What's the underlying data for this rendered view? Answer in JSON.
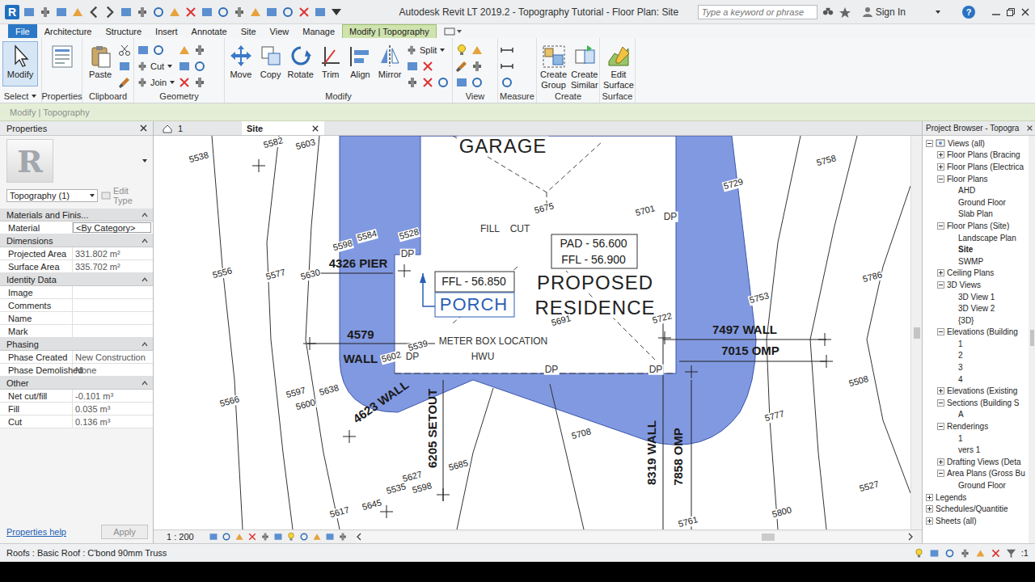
{
  "window": {
    "logo": "R",
    "title": "Autodesk Revit LT 2019.2 - Topography Tutorial - Floor Plan: Site",
    "search_placeholder": "Type a keyword or phrase",
    "sign_in": "Sign In",
    "help": "?"
  },
  "ribbon_tabs": [
    {
      "label": "File",
      "selected": false
    },
    {
      "label": "Architecture",
      "selected": false
    },
    {
      "label": "Structure",
      "selected": false
    },
    {
      "label": "Insert",
      "selected": false
    },
    {
      "label": "Annotate",
      "selected": false
    },
    {
      "label": "Site",
      "selected": false
    },
    {
      "label": "View",
      "selected": false
    },
    {
      "label": "Manage",
      "selected": false
    },
    {
      "label": "Modify | Topography",
      "selected": true
    }
  ],
  "ribbon": {
    "panels": [
      {
        "title": "Select",
        "buttons": [
          {
            "label": "Modify",
            "kind": "large",
            "pressed": true
          }
        ]
      },
      {
        "title": "Properties",
        "buttons": []
      },
      {
        "title": "Clipboard",
        "buttons": [
          {
            "label": "Paste",
            "kind": "large",
            "pressed": false
          }
        ]
      },
      {
        "title": "Geometry",
        "buttons": [
          {
            "label": "Cut",
            "kind": "small",
            "pressed": false
          },
          {
            "label": "Join",
            "kind": "small",
            "pressed": false
          }
        ]
      },
      {
        "title": "Modify",
        "buttons": [
          {
            "label": "Move",
            "kind": "large",
            "pressed": false
          },
          {
            "label": "Copy",
            "kind": "large",
            "pressed": false
          },
          {
            "label": "Rotate",
            "kind": "large",
            "pressed": false
          },
          {
            "label": "Trim",
            "kind": "large",
            "pressed": false
          },
          {
            "label": "Align",
            "kind": "large",
            "pressed": false
          },
          {
            "label": "Mirror",
            "kind": "large",
            "pressed": false
          },
          {
            "label": "Split",
            "kind": "small",
            "pressed": false
          }
        ]
      },
      {
        "title": "View",
        "buttons": []
      },
      {
        "title": "Measure",
        "buttons": []
      },
      {
        "title": "Create",
        "buttons": [
          {
            "label": "Create Group",
            "kind": "large",
            "pressed": false
          },
          {
            "label": "Create Similar",
            "kind": "large",
            "pressed": false
          }
        ]
      },
      {
        "title": "Surface",
        "buttons": [
          {
            "label": "Edit Surface",
            "kind": "large",
            "pressed": false
          }
        ]
      }
    ]
  },
  "options_bar": {
    "text": "Modify | Topography"
  },
  "properties": {
    "title": "Properties",
    "type_image": "R",
    "type_selector": "Topography (1)",
    "edit_type": {
      "label": "Edit Type",
      "disabled": true
    },
    "groups": [
      {
        "title": "Materials and Finis...",
        "rows": [
          {
            "name": "Material",
            "value": "<By Category>",
            "kind": "field"
          }
        ]
      },
      {
        "title": "Dimensions",
        "rows": [
          {
            "name": "Projected Area",
            "value": "331.802 m²",
            "kind": "readonly"
          },
          {
            "name": "Surface Area",
            "value": "335.702 m²",
            "kind": "readonly"
          }
        ]
      },
      {
        "title": "Identity Data",
        "rows": [
          {
            "name": "Image",
            "value": "",
            "kind": "readonly"
          },
          {
            "name": "Comments",
            "value": "",
            "kind": "readonly"
          },
          {
            "name": "Name",
            "value": "",
            "kind": "readonly"
          },
          {
            "name": "Mark",
            "value": "",
            "kind": "readonly"
          }
        ]
      },
      {
        "title": "Phasing",
        "rows": [
          {
            "name": "Phase Created",
            "value": "New Construction",
            "kind": "readonly"
          },
          {
            "name": "Phase Demolished",
            "value": "None",
            "kind": "readonly"
          }
        ]
      },
      {
        "title": "Other",
        "rows": [
          {
            "name": "Net cut/fill",
            "value": "-0.101 m³",
            "kind": "readonly"
          },
          {
            "name": "Fill",
            "value": "0.035 m³",
            "kind": "readonly"
          },
          {
            "name": "Cut",
            "value": "0.136 m³",
            "kind": "readonly"
          }
        ]
      }
    ],
    "help": "Properties help",
    "apply": {
      "label": "Apply",
      "disabled": true
    }
  },
  "view_tabs": [
    {
      "label": "1",
      "selected": false
    },
    {
      "label": "Site",
      "selected": true
    }
  ],
  "canvas": {
    "labels": [
      {
        "text": "5538",
        "kind": "elev"
      },
      {
        "text": "5582",
        "kind": "elev"
      },
      {
        "text": "5603",
        "kind": "elev"
      },
      {
        "text": "GARAGE",
        "kind": "title"
      },
      {
        "text": "5675",
        "kind": "elev"
      },
      {
        "text": "5701",
        "kind": "elev"
      },
      {
        "text": "DP",
        "kind": "note"
      },
      {
        "text": "5729",
        "kind": "elev"
      },
      {
        "text": "5758",
        "kind": "elev"
      },
      {
        "text": "FILL",
        "kind": "note"
      },
      {
        "text": "CUT",
        "kind": "note"
      },
      {
        "text": "PAD - 56.600",
        "kind": "note14"
      },
      {
        "text": "FFL - 56.900",
        "kind": "note14"
      },
      {
        "text": "5528",
        "kind": "elev"
      },
      {
        "text": "5598",
        "kind": "elev"
      },
      {
        "text": "5584",
        "kind": "elev"
      },
      {
        "text": "DP",
        "kind": "note"
      },
      {
        "text": "4326 PIER",
        "kind": "bold"
      },
      {
        "text": "5556",
        "kind": "elev"
      },
      {
        "text": "5577",
        "kind": "elev"
      },
      {
        "text": "5630",
        "kind": "elev"
      },
      {
        "text": "FFL - 56.850",
        "kind": "note14"
      },
      {
        "text": "PORCH",
        "kind": "porch"
      },
      {
        "text": "PROPOSED",
        "kind": "title"
      },
      {
        "text": "RESIDENCE",
        "kind": "title"
      },
      {
        "text": "5786",
        "kind": "elev"
      },
      {
        "text": "5753",
        "kind": "elev"
      },
      {
        "text": "5722",
        "kind": "elev"
      },
      {
        "text": "5691",
        "kind": "elev"
      },
      {
        "text": "7497 WALL",
        "kind": "bold"
      },
      {
        "text": "7015 OMP",
        "kind": "bold"
      },
      {
        "text": "4579",
        "kind": "bold"
      },
      {
        "text": "WALL",
        "kind": "bold"
      },
      {
        "text": "METER BOX LOCATION",
        "kind": "note"
      },
      {
        "text": "HWU",
        "kind": "note"
      },
      {
        "text": "5539",
        "kind": "elev"
      },
      {
        "text": "5602",
        "kind": "elev"
      },
      {
        "text": "DP",
        "kind": "note"
      },
      {
        "text": "DP",
        "kind": "note"
      },
      {
        "text": "DP",
        "kind": "note"
      },
      {
        "text": "5508",
        "kind": "elev"
      },
      {
        "text": "5566",
        "kind": "elev"
      },
      {
        "text": "5597",
        "kind": "elev"
      },
      {
        "text": "5600",
        "kind": "elev"
      },
      {
        "text": "5638",
        "kind": "elev"
      },
      {
        "text": "4623 WALL",
        "kind": "bold"
      },
      {
        "text": "6205 SETOUT",
        "kind": "bold"
      },
      {
        "text": "5777",
        "kind": "elev"
      },
      {
        "text": "5708",
        "kind": "elev"
      },
      {
        "text": "8319 WALL",
        "kind": "bold"
      },
      {
        "text": "7858 OMP",
        "kind": "bold"
      },
      {
        "text": "5685",
        "kind": "elev"
      },
      {
        "text": "5627",
        "kind": "elev"
      },
      {
        "text": "5535",
        "kind": "elev"
      },
      {
        "text": "5598",
        "kind": "elev"
      },
      {
        "text": "5527",
        "kind": "elev"
      },
      {
        "text": "5617",
        "kind": "elev"
      },
      {
        "text": "5645",
        "kind": "elev"
      },
      {
        "text": "5800",
        "kind": "elev"
      },
      {
        "text": "5761",
        "kind": "elev"
      }
    ]
  },
  "view_bar": {
    "scale": "1 : 200"
  },
  "project_browser": {
    "title": "Project Browser - Topogra",
    "items": [
      {
        "label": "Views (all)",
        "expanded": true,
        "children": [
          {
            "label": "Floor Plans (Bracing",
            "expanded": false
          },
          {
            "label": "Floor Plans (Electrica",
            "expanded": false
          },
          {
            "label": "Floor Plans",
            "expanded": true,
            "children": [
              {
                "label": "AHD",
                "selected": false
              },
              {
                "label": "Ground Floor",
                "selected": false
              },
              {
                "label": "Slab Plan",
                "selected": false
              }
            ]
          },
          {
            "label": "Floor Plans (Site)",
            "expanded": true,
            "children": [
              {
                "label": "Landscape Plan",
                "selected": false
              },
              {
                "label": "Site",
                "selected": true
              },
              {
                "label": "SWMP",
                "selected": false
              }
            ]
          },
          {
            "label": "Ceiling Plans",
            "expanded": false
          },
          {
            "label": "3D Views",
            "expanded": true,
            "children": [
              {
                "label": "3D View 1",
                "selected": false
              },
              {
                "label": "3D View 2",
                "selected": false
              },
              {
                "label": "{3D}",
                "selected": false
              }
            ]
          },
          {
            "label": "Elevations (Building",
            "expanded": true,
            "children": [
              {
                "label": "1",
                "selected": false
              },
              {
                "label": "2",
                "selected": false
              },
              {
                "label": "3",
                "selected": false
              },
              {
                "label": "4",
                "selected": false
              }
            ]
          },
          {
            "label": "Elevations (Existing",
            "expanded": false
          },
          {
            "label": "Sections (Building S",
            "expanded": true,
            "children": [
              {
                "label": "A",
                "selected": false
              }
            ]
          },
          {
            "label": "Renderings",
            "expanded": true,
            "children": [
              {
                "label": "1",
                "selected": false
              },
              {
                "label": "vers 1",
                "selected": false
              }
            ]
          },
          {
            "label": "Drafting Views (Deta",
            "expanded": false
          },
          {
            "label": "Area Plans (Gross Bu",
            "expanded": true,
            "children": [
              {
                "label": "Ground Floor",
                "selected": false
              }
            ]
          }
        ]
      },
      {
        "label": "Legends",
        "expanded": false
      },
      {
        "label": "Schedules/Quantitie",
        "expanded": false
      },
      {
        "label": "Sheets (all)",
        "expanded": false
      }
    ]
  },
  "status_bar": {
    "text": "Roofs : Basic Roof : C'bond 90mm Truss",
    "filter_count": ":1"
  }
}
